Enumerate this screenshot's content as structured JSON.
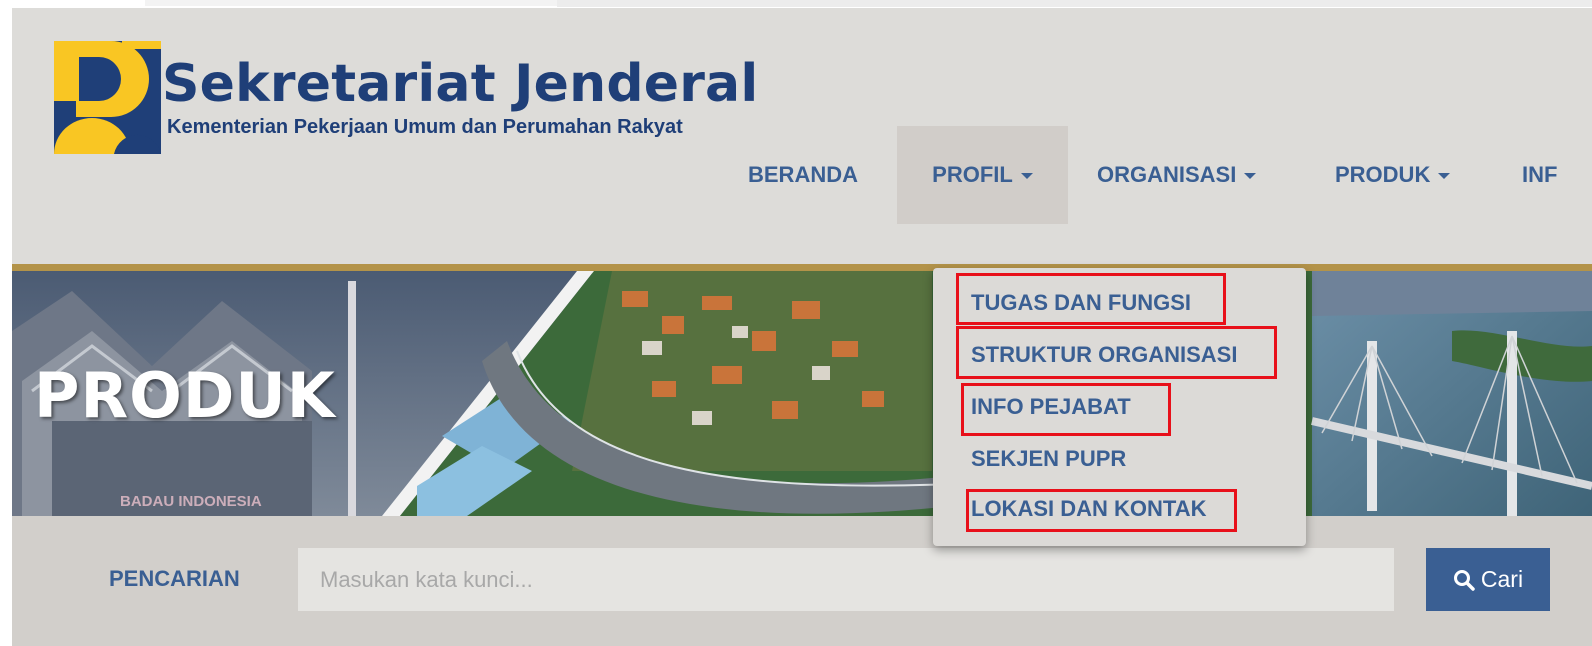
{
  "site": {
    "brand_title": "Sekretariat Jenderal",
    "brand_subtitle": "Kementerian Pekerjaan Umum dan Perumahan Rakyat"
  },
  "nav": {
    "items": [
      {
        "label": "BERANDA",
        "has_caret": false
      },
      {
        "label": "PROFIL",
        "has_caret": true,
        "active": true
      },
      {
        "label": "ORGANISASI",
        "has_caret": true
      },
      {
        "label": "PRODUK",
        "has_caret": true
      },
      {
        "label": "INF",
        "has_caret": false
      }
    ]
  },
  "dropdown": {
    "items": [
      {
        "label": "TUGAS DAN FUNGSI",
        "highlighted": true
      },
      {
        "label": "STRUKTUR ORGANISASI",
        "highlighted": true
      },
      {
        "label": "INFO PEJABAT",
        "highlighted": true
      },
      {
        "label": "SEKJEN PUPR",
        "highlighted": false
      },
      {
        "label": "LOKASI DAN KONTAK",
        "highlighted": true
      }
    ]
  },
  "banner": {
    "title": "PRODUK",
    "sign_text": "BADAU INDONESIA"
  },
  "search": {
    "label": "PENCARIAN",
    "placeholder": "Masukan kata kunci...",
    "value": "",
    "button_label": "Cari",
    "button_icon": "search-icon"
  },
  "colors": {
    "brand_blue": "#1f3f78",
    "nav_text": "#3a5f93",
    "logo_yellow": "#f9c623",
    "accent_gold": "#b39349",
    "highlight_red": "#e8101a"
  }
}
